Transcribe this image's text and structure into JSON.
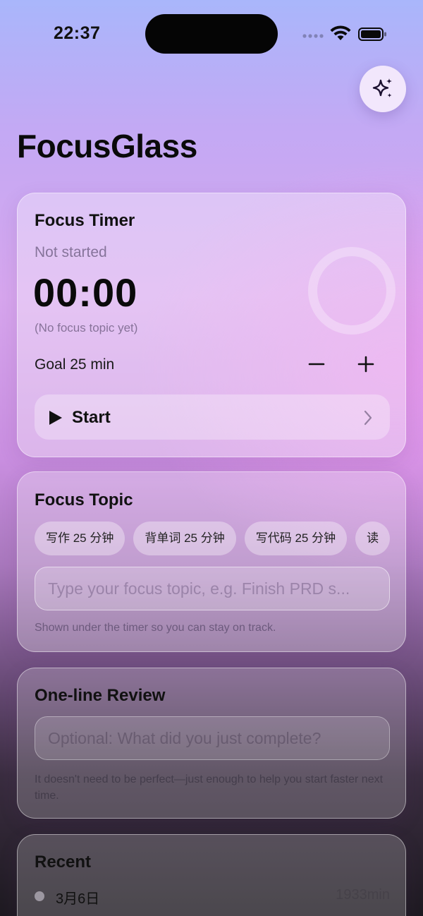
{
  "status_bar": {
    "time": "22:37"
  },
  "header": {
    "title": "FocusGlass",
    "action_icon": "sparkles-icon"
  },
  "timer": {
    "title": "Focus Timer",
    "status": "Not started",
    "time": "00:00",
    "topic": "(No focus topic yet)",
    "goal_label": "Goal 25 min",
    "start_label": "Start"
  },
  "topic": {
    "title": "Focus Topic",
    "chips": [
      "写作 25 分钟",
      "背单词 25 分钟",
      "写代码 25 分钟",
      "读"
    ],
    "placeholder": "Type your focus topic, e.g. Finish PRD s...",
    "hint": "Shown under the timer so you can stay on track."
  },
  "review": {
    "title": "One-line Review",
    "placeholder": "Optional: What did you just complete?",
    "hint": "It doesn't need to be perfect—just enough to help you start faster next time."
  },
  "recent": {
    "title": "Recent",
    "items": [
      {
        "date": "3月6日",
        "minutes": "1933min"
      }
    ]
  }
}
